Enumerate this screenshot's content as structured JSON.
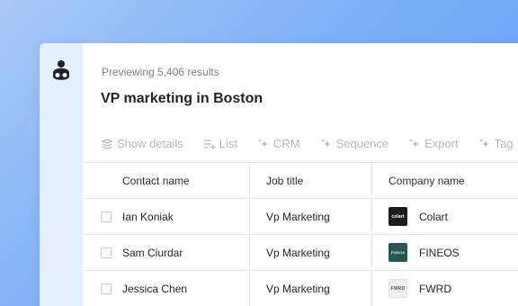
{
  "header": {
    "preview_text": "Previewing 5,406 results",
    "title": "VP marketing in Boston"
  },
  "toolbar": [
    {
      "label": "Show details",
      "icon": "show-details-icon"
    },
    {
      "label": "List",
      "icon": "list-add-icon"
    },
    {
      "label": "CRM",
      "icon": "crm-sparkle-icon"
    },
    {
      "label": "Sequence",
      "icon": "sequence-sparkle-icon"
    },
    {
      "label": "Export",
      "icon": "export-sparkle-icon"
    },
    {
      "label": "Tag",
      "icon": "tag-sparkle-icon"
    }
  ],
  "table": {
    "columns": [
      "Contact name",
      "Job title",
      "Company name"
    ],
    "rows": [
      {
        "contact": "Ian Koniak",
        "job": "Vp Marketing",
        "company": "Colart",
        "logo_text": "colart",
        "logo_bg": "#1c1c1c",
        "logo_fg": "#ffffff"
      },
      {
        "contact": "Sam Ciurdar",
        "job": "Vp Marketing",
        "company": "FINEOS",
        "logo_text": "FINEOS",
        "logo_bg": "#2c5656",
        "logo_fg": "#d8e6e4"
      },
      {
        "contact": "Jessica Chen",
        "job": "Vp Marketing",
        "company": "FWRD",
        "logo_text": "FWRD",
        "logo_bg": "#f1f1f1",
        "logo_fg": "#555555"
      }
    ]
  },
  "colors": {
    "background_gradient": [
      "#a9c8f7",
      "#5f9cf4"
    ],
    "sidebar": "#e4effd",
    "toolbar_text": "#b3b8c0"
  }
}
